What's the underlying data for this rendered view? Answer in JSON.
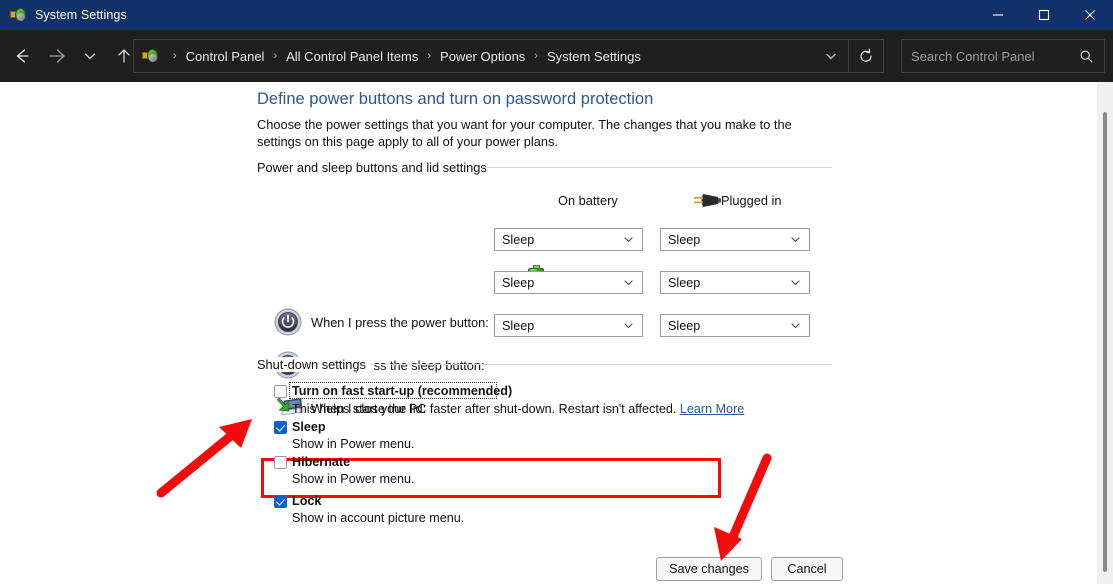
{
  "window": {
    "title": "System Settings",
    "icon": "power-options-icon",
    "controls": {
      "minimize": "minimize-icon",
      "maximize": "maximize-icon",
      "close": "close-icon"
    }
  },
  "nav": {
    "back": "back-arrow-icon",
    "forward": "forward-arrow-icon",
    "recent": "chevron-down-icon",
    "up": "up-arrow-icon",
    "breadcrumb": [
      "Control Panel",
      "All Control Panel Items",
      "Power Options",
      "System Settings"
    ],
    "breadcrumb_separator": "›",
    "history_dropdown": "chevron-down-icon",
    "refresh": "refresh-icon",
    "search": {
      "placeholder": "Search Control Panel",
      "value": "",
      "icon": "search-icon"
    }
  },
  "page": {
    "title": "Define power buttons and turn on password protection",
    "description": "Choose the power settings that you want for your computer. The changes that you make to the settings on this page apply to all of your power plans.",
    "title_color": "#2a5699"
  },
  "power_section": {
    "heading": "Power and sleep buttons and lid settings",
    "columns": [
      {
        "label": "On battery",
        "icon": "battery-icon"
      },
      {
        "label": "Plugged in",
        "icon": "power-plug-icon"
      }
    ],
    "rows": [
      {
        "icon": "power-button-icon",
        "label": "When I press the power button:",
        "on_battery": "Sleep",
        "plugged_in": "Sleep"
      },
      {
        "icon": "sleep-moon-icon",
        "label": "When I press the sleep button:",
        "on_battery": "Sleep",
        "plugged_in": "Sleep"
      },
      {
        "icon": "laptop-lid-icon",
        "label": "When I close the lid:",
        "on_battery": "Sleep",
        "plugged_in": "Sleep"
      }
    ]
  },
  "shutdown_section": {
    "heading": "Shut-down settings",
    "highlight_color": "#f30b0b",
    "items": [
      {
        "label": "Turn on fast start-up (recommended)",
        "checked": false,
        "focused": true,
        "sub": "This helps start your PC faster after shut-down. Restart isn't affected.",
        "link": "Learn More"
      },
      {
        "label": "Sleep",
        "checked": true,
        "focused": false,
        "sub": "Show in Power menu.",
        "link": ""
      },
      {
        "label": "Hibernate",
        "checked": false,
        "focused": false,
        "sub": "Show in Power menu.",
        "link": ""
      },
      {
        "label": "Lock",
        "checked": true,
        "focused": false,
        "sub": "Show in account picture menu.",
        "link": ""
      }
    ]
  },
  "footer": {
    "save_label": "Save changes",
    "cancel_label": "Cancel"
  },
  "annotations": {
    "arrow_color": "#f30b0b",
    "arrow_1": "arrow-pointing-to-fast-startup",
    "arrow_2": "arrow-pointing-to-save-changes"
  }
}
